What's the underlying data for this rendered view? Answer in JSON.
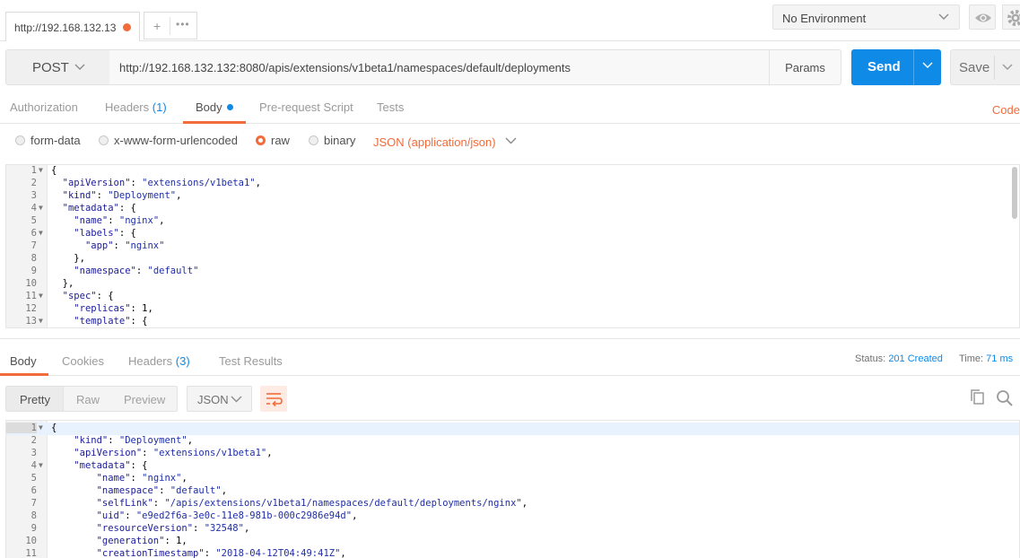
{
  "tab": {
    "title": "http://192.168.132.13"
  },
  "environment": {
    "selected": "No Environment"
  },
  "request": {
    "method": "POST",
    "url": "http://192.168.132.132:8080/apis/extensions/v1beta1/namespaces/default/deployments",
    "params_label": "Params",
    "send_label": "Send",
    "save_label": "Save"
  },
  "request_tabs": {
    "authorization": "Authorization",
    "headers": "Headers",
    "headers_count": "(1)",
    "body": "Body",
    "pre_request": "Pre-request Script",
    "tests": "Tests",
    "code": "Code"
  },
  "body_types": {
    "form_data": "form-data",
    "urlencoded": "x-www-form-urlencoded",
    "raw": "raw",
    "binary": "binary",
    "content_type": "JSON (application/json)"
  },
  "request_body": [
    {
      "n": "1",
      "fold": true,
      "code": "{"
    },
    {
      "n": "2",
      "code": "  \"apiVersion\": \"extensions/v1beta1\","
    },
    {
      "n": "3",
      "code": "  \"kind\": \"Deployment\","
    },
    {
      "n": "4",
      "fold": true,
      "code": "  \"metadata\": {"
    },
    {
      "n": "5",
      "code": "    \"name\": \"nginx\","
    },
    {
      "n": "6",
      "fold": true,
      "code": "    \"labels\": {"
    },
    {
      "n": "7",
      "code": "      \"app\": \"nginx\""
    },
    {
      "n": "8",
      "code": "    },"
    },
    {
      "n": "9",
      "code": "    \"namespace\": \"default\""
    },
    {
      "n": "10",
      "code": "  },"
    },
    {
      "n": "11",
      "fold": true,
      "code": "  \"spec\": {"
    },
    {
      "n": "12",
      "code": "    \"replicas\": 1,"
    },
    {
      "n": "13",
      "fold": true,
      "code": "    \"template\": {"
    }
  ],
  "response_tabs": {
    "body": "Body",
    "cookies": "Cookies",
    "headers": "Headers",
    "headers_count": "(3)",
    "test_results": "Test Results"
  },
  "response_status": {
    "status_label": "Status:",
    "status_value": "201 Created",
    "time_label": "Time:",
    "time_value": "71 ms"
  },
  "view_modes": {
    "pretty": "Pretty",
    "raw": "Raw",
    "preview": "Preview",
    "language": "JSON"
  },
  "response_body": [
    {
      "n": "1",
      "fold": true,
      "code": "{"
    },
    {
      "n": "2",
      "code": "    \"kind\": \"Deployment\","
    },
    {
      "n": "3",
      "code": "    \"apiVersion\": \"extensions/v1beta1\","
    },
    {
      "n": "4",
      "fold": true,
      "code": "    \"metadata\": {"
    },
    {
      "n": "5",
      "code": "        \"name\": \"nginx\","
    },
    {
      "n": "6",
      "code": "        \"namespace\": \"default\","
    },
    {
      "n": "7",
      "code": "        \"selfLink\": \"/apis/extensions/v1beta1/namespaces/default/deployments/nginx\","
    },
    {
      "n": "8",
      "code": "        \"uid\": \"e9ed2f6a-3e0c-11e8-981b-000c2986e94d\","
    },
    {
      "n": "9",
      "code": "        \"resourceVersion\": \"32548\","
    },
    {
      "n": "10",
      "code": "        \"generation\": 1,"
    },
    {
      "n": "11",
      "code": "        \"creationTimestamp\": \"2018-04-12T04:49:41Z\","
    }
  ],
  "icons": {
    "tab_dirty": "orange-dot-icon",
    "new_tab": "plus-icon",
    "more": "ellipsis-icon",
    "env_dropdown": "chevron-down-icon",
    "env_quick_look": "eye-icon",
    "settings": "gear-icon",
    "wrap": "wrap-lines-icon",
    "copy": "copy-icon",
    "search": "search-icon"
  },
  "colors": {
    "accent": "#f26b3a",
    "primary": "#0f8ae6"
  }
}
